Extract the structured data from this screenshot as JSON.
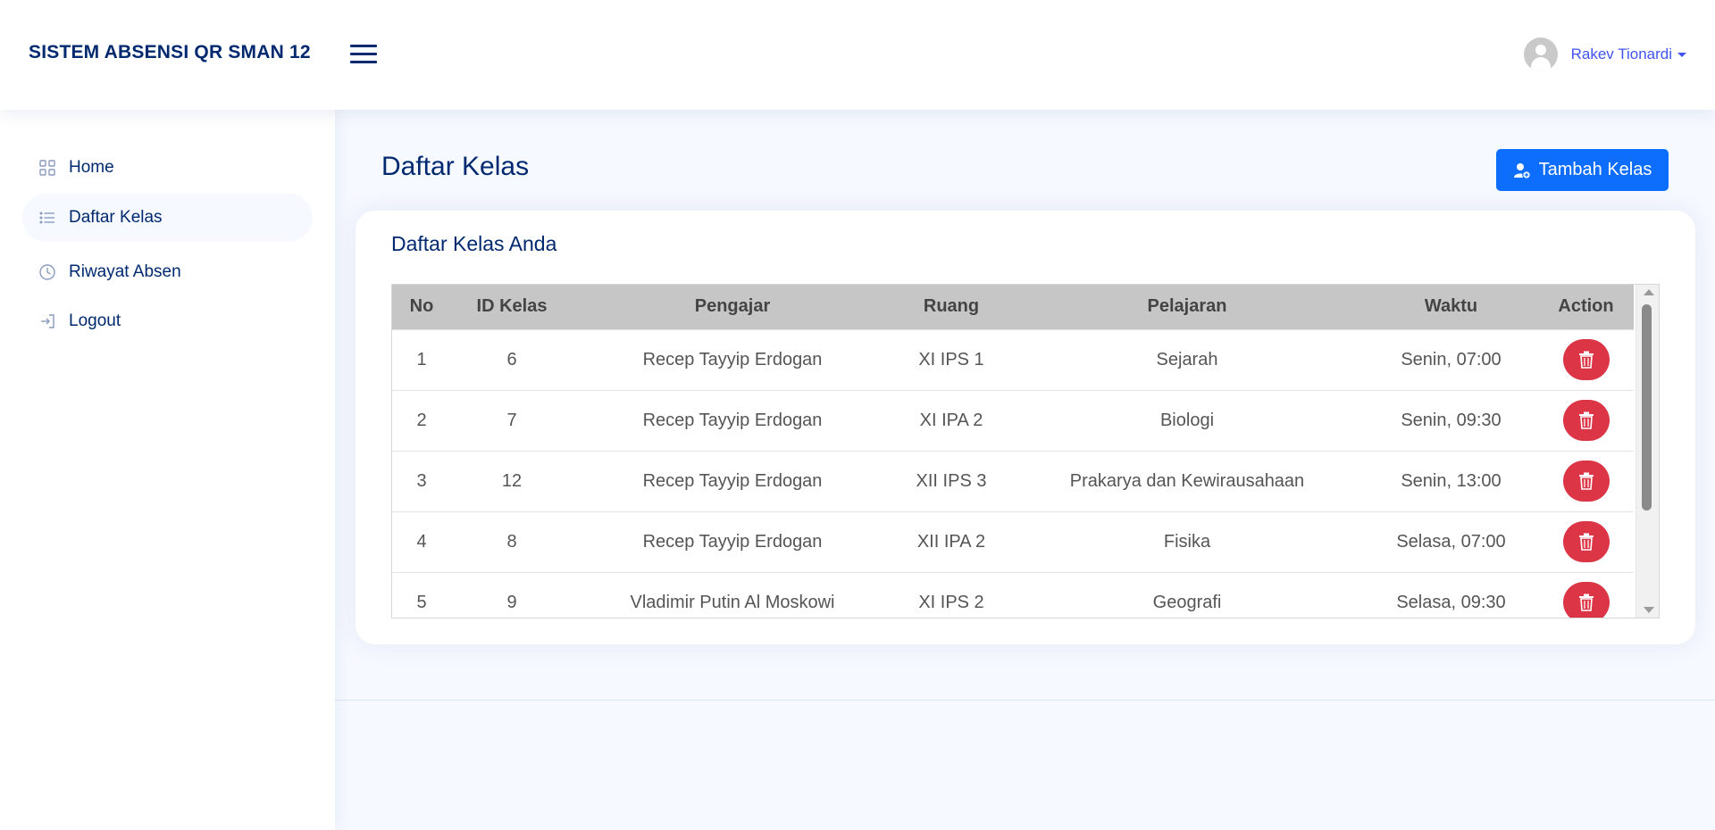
{
  "header": {
    "brand": "SISTEM ABSENSI QR SMAN 12",
    "user_name": "Rakev Tionardi"
  },
  "sidebar": {
    "items": [
      {
        "label": "Home",
        "icon": "grid-icon"
      },
      {
        "label": "Daftar Kelas",
        "icon": "list-icon",
        "active": true
      },
      {
        "label": "Riwayat Absen",
        "icon": "clock-icon"
      },
      {
        "label": "Logout",
        "icon": "logout-icon"
      }
    ]
  },
  "main": {
    "page_title": "Daftar Kelas",
    "add_button_label": "Tambah Kelas",
    "card_title": "Daftar Kelas Anda",
    "table": {
      "headers": [
        "No",
        "ID Kelas",
        "Pengajar",
        "Ruang",
        "Pelajaran",
        "Waktu",
        "Action"
      ],
      "rows": [
        {
          "no": "1",
          "id": "6",
          "pengajar": "Recep Tayyip Erdogan",
          "ruang": "XI IPS 1",
          "pelajaran": "Sejarah",
          "waktu": "Senin, 07:00"
        },
        {
          "no": "2",
          "id": "7",
          "pengajar": "Recep Tayyip Erdogan",
          "ruang": "XI IPA 2",
          "pelajaran": "Biologi",
          "waktu": "Senin, 09:30"
        },
        {
          "no": "3",
          "id": "12",
          "pengajar": "Recep Tayyip Erdogan",
          "ruang": "XII IPS 3",
          "pelajaran": "Prakarya dan Kewirausahaan",
          "waktu": "Senin, 13:00"
        },
        {
          "no": "4",
          "id": "8",
          "pengajar": "Recep Tayyip Erdogan",
          "ruang": "XII IPA 2",
          "pelajaran": "Fisika",
          "waktu": "Selasa, 07:00"
        },
        {
          "no": "5",
          "id": "9",
          "pengajar": "Vladimir Putin Al Moskowi",
          "ruang": "XI IPS 2",
          "pelajaran": "Geografi",
          "waktu": "Selasa, 09:30"
        }
      ]
    }
  },
  "colors": {
    "brand_navy": "#012970",
    "accent_blue": "#4154f1",
    "primary_button": "#0d6efd",
    "danger": "#dc3545",
    "table_header_bg": "#c6c6c6",
    "page_bg": "#f6f9ff"
  }
}
